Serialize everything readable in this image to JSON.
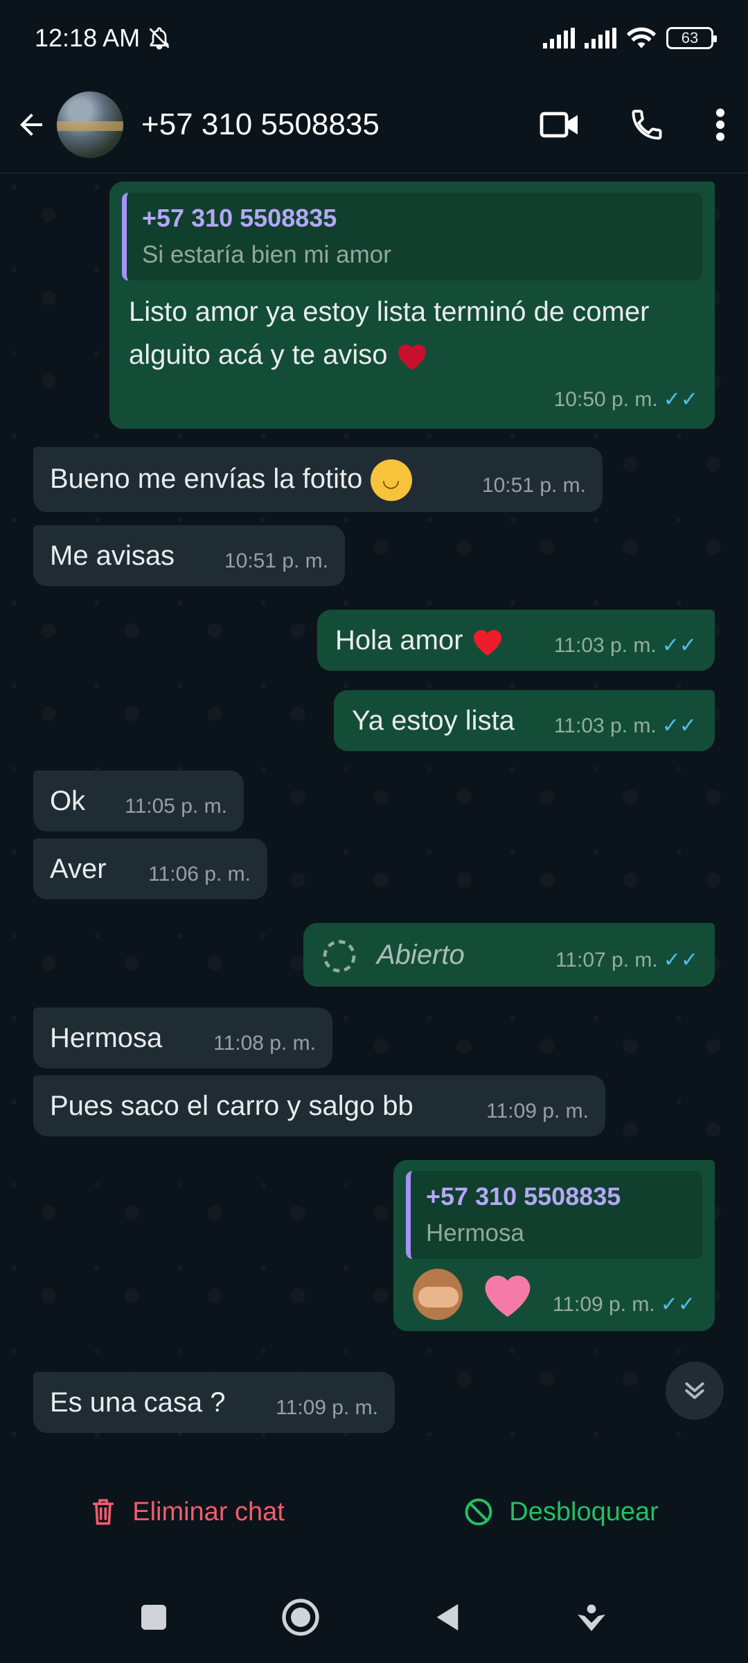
{
  "status": {
    "time": "12:18 AM",
    "battery": "63"
  },
  "header": {
    "contact": "+57 310 5508835"
  },
  "messages": {
    "m1": {
      "quote_name": "+57 310 5508835",
      "quote_text": "Si estaría bien mi amor",
      "text": "Listo amor ya estoy lista terminó de comer alguito acá y te aviso",
      "time": "10:50 p. m."
    },
    "m2": {
      "text": "Bueno me envías la fotito",
      "time": "10:51 p. m."
    },
    "m3": {
      "text": "Me avisas",
      "time": "10:51 p. m."
    },
    "m4": {
      "text": "Hola amor",
      "time": "11:03 p. m."
    },
    "m5": {
      "text": "Ya estoy lista",
      "time": "11:03 p. m."
    },
    "m6": {
      "text": "Ok",
      "time": "11:05 p. m."
    },
    "m7": {
      "text": "Aver",
      "time": "11:06 p. m."
    },
    "m8": {
      "text": "Abierto",
      "time": "11:07 p. m."
    },
    "m9": {
      "text": "Hermosa",
      "time": "11:08 p. m."
    },
    "m10": {
      "text": "Pues saco el carro y salgo bb",
      "time": "11:09 p. m."
    },
    "m11": {
      "quote_name": "+57 310 5508835",
      "quote_text": "Hermosa",
      "time": "11:09 p. m."
    },
    "m12": {
      "text": "Es una casa ?",
      "time": "11:09 p. m."
    }
  },
  "actions": {
    "delete": "Eliminar chat",
    "unblock": "Desbloquear"
  },
  "colors": {
    "accent_green": "#21c063",
    "delete_red": "#f15c6d",
    "read_ticks": "#53bdeb",
    "out_bubble": "#144d37",
    "in_bubble": "#202c33"
  }
}
